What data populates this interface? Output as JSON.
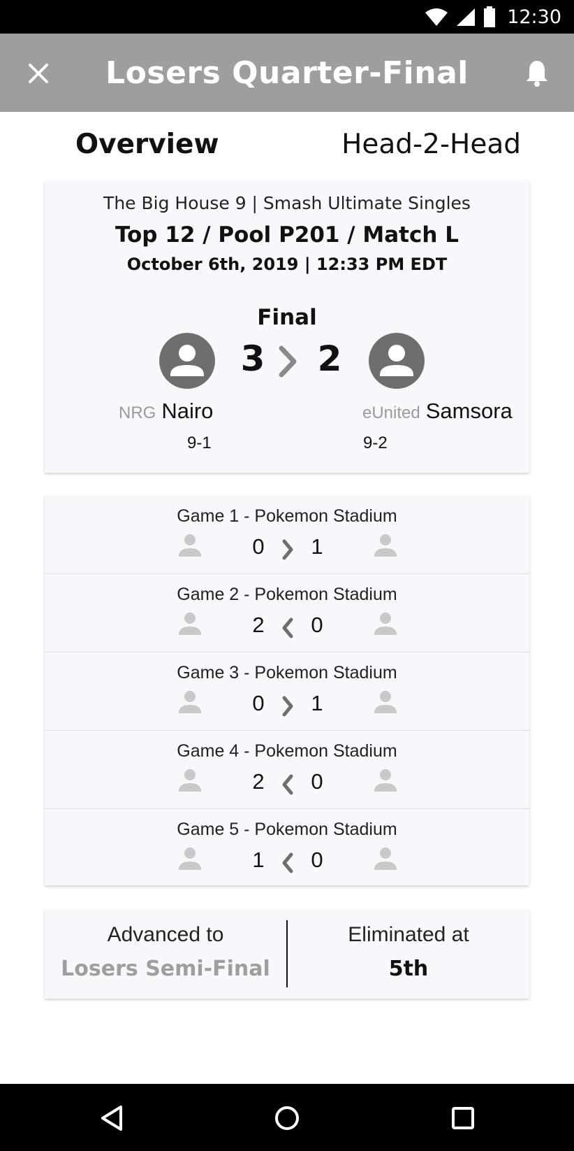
{
  "status_bar": {
    "time": "12:30"
  },
  "app_bar": {
    "title": "Losers Quarter-Final",
    "close_icon": "close-icon",
    "bell_icon": "bell-icon"
  },
  "tabs": [
    {
      "label": "Overview",
      "active": true
    },
    {
      "label": "Head-2-Head",
      "active": false
    }
  ],
  "match": {
    "event": "The Big House 9 | Smash Ultimate Singles",
    "path": "Top 12 / Pool P201 / Match L",
    "date": "October 6th, 2019 | 12:33 PM EDT",
    "status": "Final",
    "score_left": "3",
    "score_right": "2",
    "player_left": {
      "sponsor": "NRG",
      "name": "Nairo",
      "record": "9-1"
    },
    "player_right": {
      "sponsor": "eUnited",
      "name": "Samsora",
      "record": "9-2"
    }
  },
  "games": [
    {
      "title": "Game 1 - Pokemon Stadium",
      "left": "0",
      "right": "1",
      "winner": "right"
    },
    {
      "title": "Game 2 - Pokemon Stadium",
      "left": "2",
      "right": "0",
      "winner": "left"
    },
    {
      "title": "Game 3 - Pokemon Stadium",
      "left": "0",
      "right": "1",
      "winner": "right"
    },
    {
      "title": "Game 4 - Pokemon Stadium",
      "left": "2",
      "right": "0",
      "winner": "left"
    },
    {
      "title": "Game 5 - Pokemon Stadium",
      "left": "1",
      "right": "0",
      "winner": "left"
    }
  ],
  "result": {
    "advanced_label": "Advanced to",
    "advanced_value": "Losers Semi-Final",
    "eliminated_label": "Eliminated at",
    "eliminated_value": "5th"
  },
  "colors": {
    "app_bar": "#9e9e9e",
    "card": "#f7f8fc",
    "avatar": "#6e6e6e",
    "muted": "#9e9e9e"
  }
}
